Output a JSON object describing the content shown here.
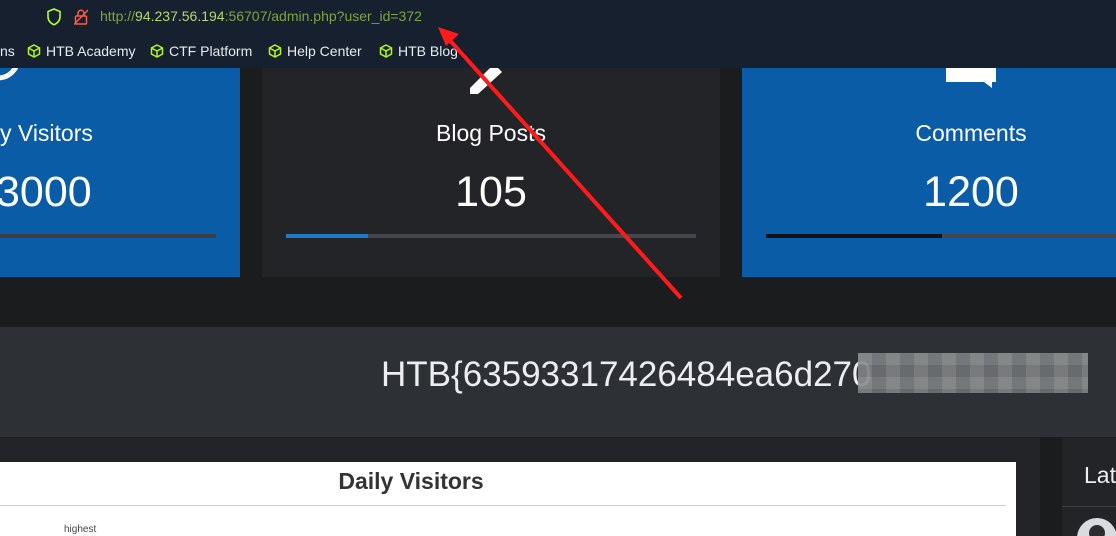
{
  "browser": {
    "url_prefix": "http://",
    "url_host": "94.237.56.194",
    "url_rest": ":56707/admin.php?user_id=372",
    "bookmarks": [
      {
        "label": "ns"
      },
      {
        "label": "HTB Academy"
      },
      {
        "label": "CTF Platform"
      },
      {
        "label": "Help Center"
      },
      {
        "label": "HTB Blog"
      }
    ]
  },
  "stats": [
    {
      "title": "y Visitors",
      "value": "3000",
      "progress": 1.0
    },
    {
      "title": "Blog Posts",
      "value": "105",
      "progress": 0.2
    },
    {
      "title": "Comments",
      "value": "1200",
      "progress": 0.47
    }
  ],
  "flag": {
    "visible": "HTB{63593317426484ea6d270"
  },
  "chart": {
    "title": "Daily Visitors",
    "note": "highest"
  },
  "sidebar": {
    "title": "Lat"
  },
  "colors": {
    "brand_blue": "#0a5ca6",
    "accent_blue": "#1f7ac8",
    "bookmark_icon": "#b2f61d",
    "arrow_red": "#ff1b1b"
  }
}
